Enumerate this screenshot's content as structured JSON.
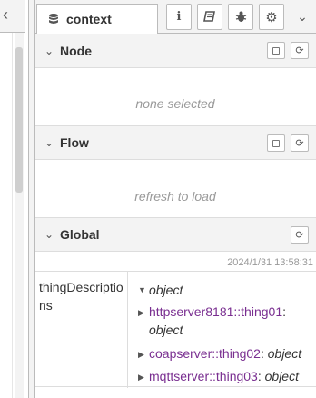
{
  "sidebar": {
    "tab_title": "context",
    "toolbar": {
      "info_icon": "info-icon",
      "book_icon": "book-icon",
      "debug_icon": "bug-icon",
      "config_icon": "gear-icon",
      "menu_icon": "chevron-down-icon"
    }
  },
  "sections": {
    "node": {
      "title": "Node",
      "message": "none selected"
    },
    "flow": {
      "title": "Flow",
      "message": "refresh to load"
    },
    "global": {
      "title": "Global",
      "timestamp": "2024/1/31 13:58:31",
      "key": "thingDescriptions",
      "root_type": "object",
      "items": [
        {
          "key": "httpserver8181::thing01",
          "type": "object"
        },
        {
          "key": "coapserver::thing02",
          "type": "object"
        },
        {
          "key": "mqttserver::thing03",
          "type": "object"
        }
      ]
    }
  },
  "colors": {
    "accent_key": "#792e90",
    "header_bg": "#f3f3f3",
    "muted_text": "#999999"
  }
}
